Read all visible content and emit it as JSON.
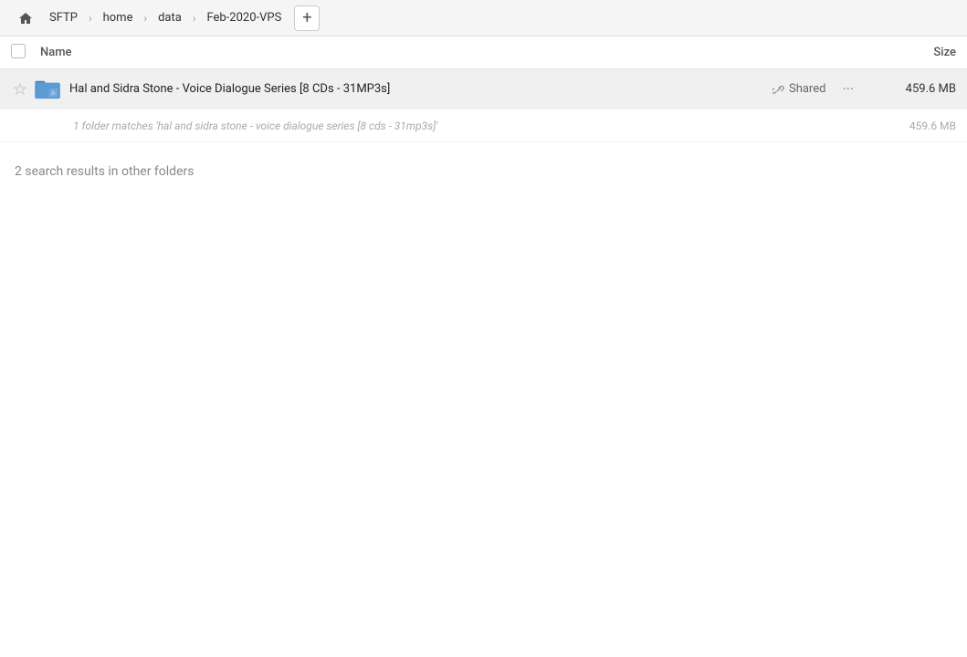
{
  "header": {
    "home_icon": "🏠",
    "breadcrumbs": [
      {
        "label": "SFTP",
        "id": "sftp"
      },
      {
        "label": "home",
        "id": "home"
      },
      {
        "label": "data",
        "id": "data"
      },
      {
        "label": "Feb-2020-VPS",
        "id": "feb-2020-vps"
      }
    ],
    "add_tab_label": "+"
  },
  "columns": {
    "name_label": "Name",
    "size_label": "Size"
  },
  "file_row": {
    "name": "Hal and Sidra Stone - Voice Dialogue Series [8 CDs - 31MP3s]",
    "shared_label": "Shared",
    "more_label": "···",
    "size": "459.6 MB"
  },
  "match_row": {
    "text": "1 folder matches 'hal and sidra stone - voice dialogue series [8 cds - 31mp3s]'",
    "size": "459.6 MB"
  },
  "other_results": {
    "label": "2 search results in other folders"
  },
  "colors": {
    "accent_blue": "#4a90d9",
    "folder_blue": "#5b9bd5",
    "folder_dark": "#4a7fb5",
    "shared_link": "#888888",
    "star_empty": "#cccccc"
  }
}
